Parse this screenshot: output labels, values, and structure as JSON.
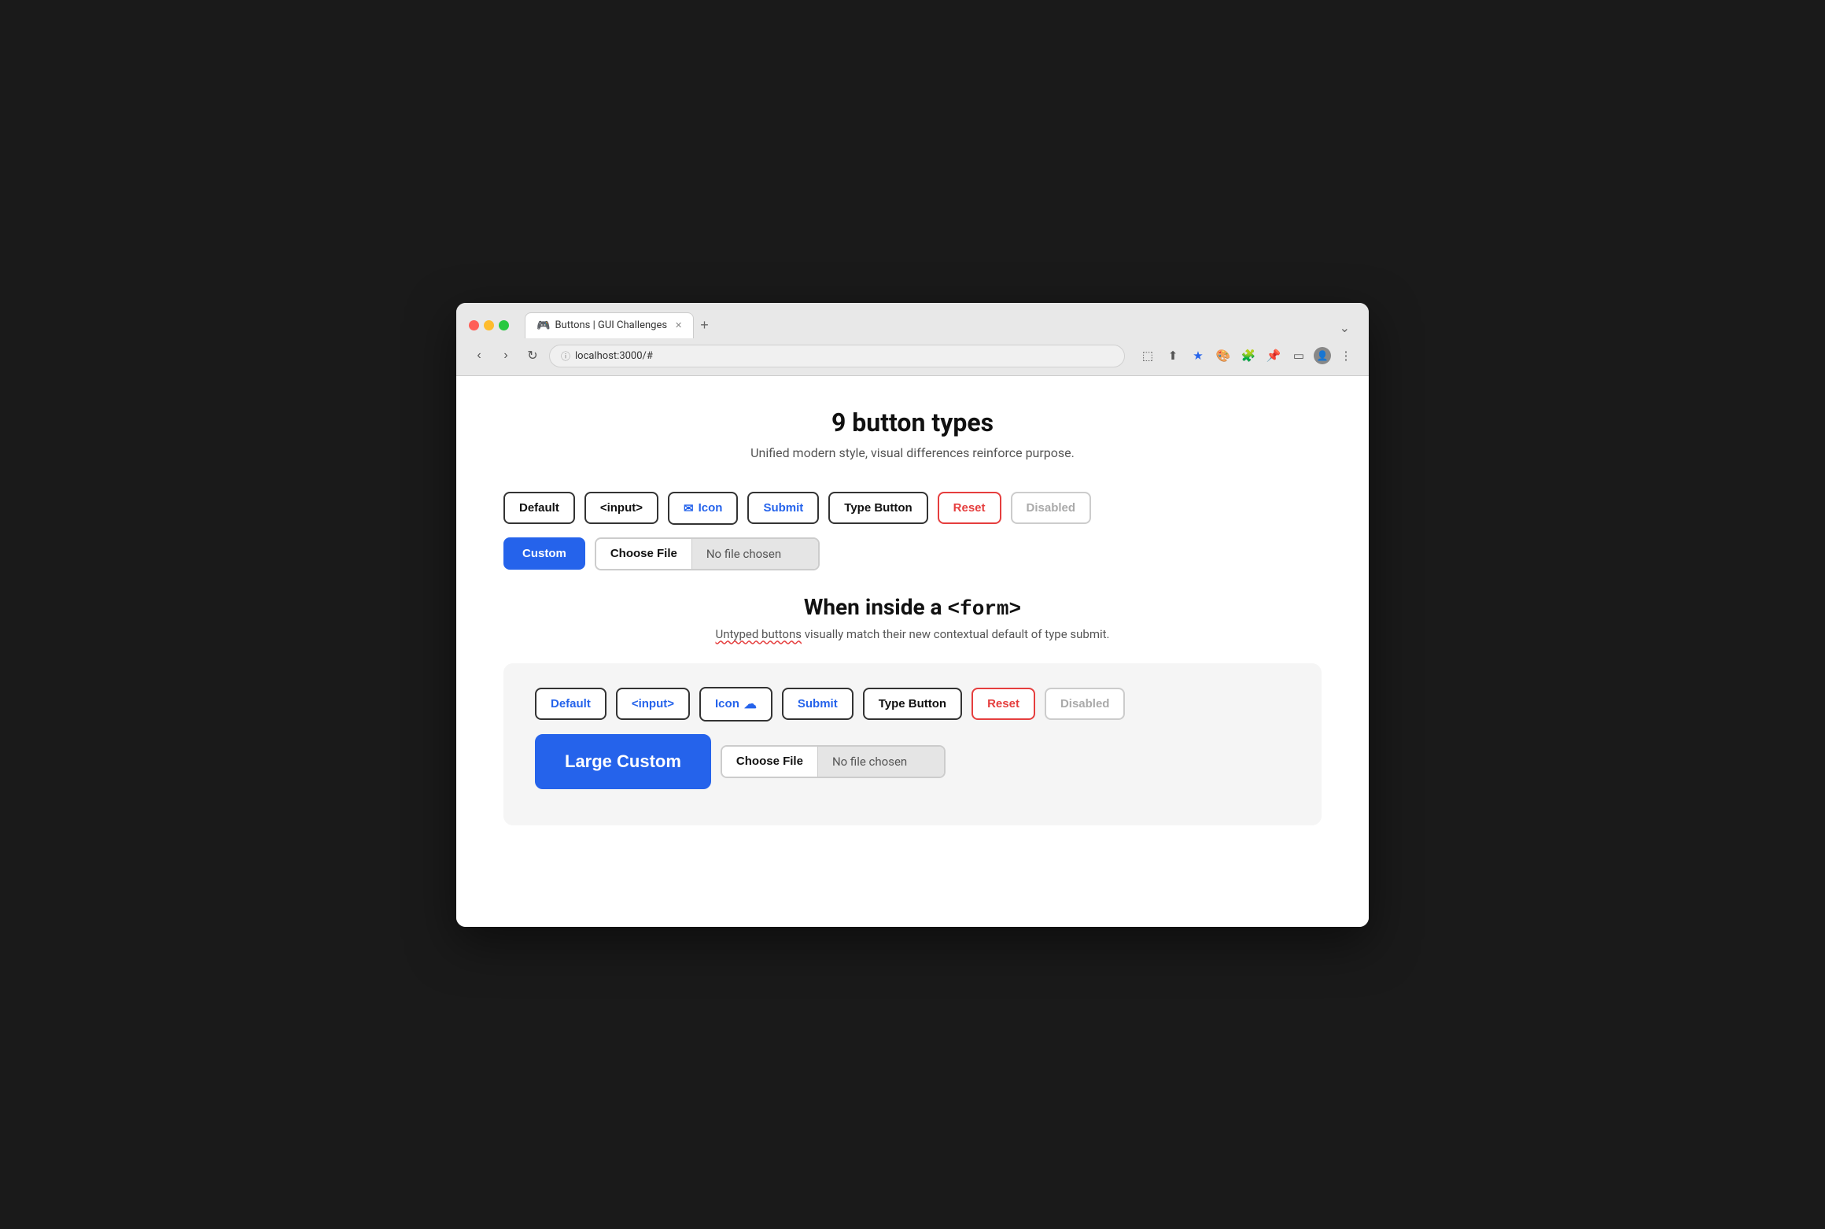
{
  "browser": {
    "tab_title": "Buttons | GUI Challenges",
    "url": "localhost:3000/#",
    "tab_icon": "🎮"
  },
  "page": {
    "main_title": "9 button types",
    "main_subtitle": "Unified modern style, visual differences reinforce purpose.",
    "section2_title_text": "When inside a ",
    "section2_title_code": "<form>",
    "section2_subtitle_prefix": "Untyped buttons",
    "section2_subtitle_suffix": " visually match their new contextual default of type submit."
  },
  "row1": {
    "default": "Default",
    "input": "<input>",
    "icon": "Icon",
    "submit": "Submit",
    "type_button": "Type Button",
    "reset": "Reset",
    "disabled": "Disabled"
  },
  "row2": {
    "custom": "Custom",
    "choose_file": "Choose File",
    "no_file_chosen": "No file chosen"
  },
  "form_row1": {
    "default": "Default",
    "input": "<input>",
    "icon": "Icon",
    "submit": "Submit",
    "type_button": "Type Button",
    "reset": "Reset",
    "disabled": "Disabled"
  },
  "form_row2": {
    "large_custom": "Large Custom",
    "choose_file": "Choose File",
    "no_file_chosen": "No file chosen"
  }
}
